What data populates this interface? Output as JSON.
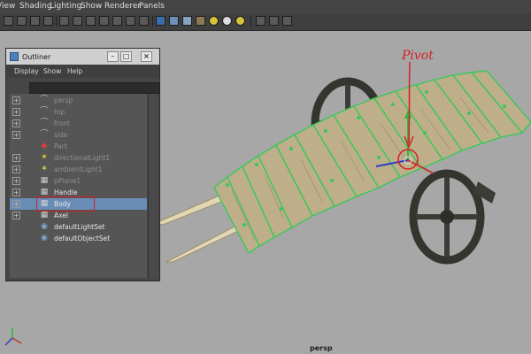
{
  "menu": [
    "View",
    "Shading",
    "Lighting",
    "Show",
    "Renderer",
    "Panels"
  ],
  "toolbar_icons": [
    "select-camera-icon",
    "camera-attributes-icon",
    "bookmark-icon",
    "image-plane-icon",
    "grid-icon",
    "film-gate-icon",
    "resolution-gate-icon",
    "gate-mask-icon",
    "field-chart-icon",
    "safe-action-icon",
    "safe-title-icon",
    "wireframe-icon",
    "smooth-shade-icon",
    "wireframe-on-shaded-icon",
    "textured-icon",
    "use-all-lights-icon",
    "shadows-icon",
    "isolate-select-icon",
    "xray-icon",
    "xray-joints-icon"
  ],
  "outliner": {
    "title": "Outliner",
    "menu": [
      "Display",
      "Show",
      "Help"
    ],
    "items": [
      {
        "label": "persp",
        "icon": "camera-icon",
        "dim": true,
        "expand": "+"
      },
      {
        "label": "top",
        "icon": "camera-icon",
        "dim": true,
        "expand": "+"
      },
      {
        "label": "front",
        "icon": "camera-icon",
        "dim": true,
        "expand": "+"
      },
      {
        "label": "side",
        "icon": "camera-icon",
        "dim": true,
        "expand": "+"
      },
      {
        "label": "Part",
        "icon": "group-icon",
        "dim": true,
        "expand": ""
      },
      {
        "label": "directionalLight1",
        "icon": "light-icon",
        "dim": true,
        "expand": "+"
      },
      {
        "label": "ambientLight1",
        "icon": "light-icon",
        "dim": true,
        "expand": "+"
      },
      {
        "label": "pPlane1",
        "icon": "mesh-icon",
        "dim": true,
        "expand": "+"
      },
      {
        "label": "Handle",
        "icon": "mesh-icon",
        "dim": false,
        "expand": "+"
      },
      {
        "label": "Body",
        "icon": "mesh-icon",
        "dim": false,
        "expand": "+",
        "selected": true
      },
      {
        "label": "Axel",
        "icon": "mesh-icon",
        "dim": false,
        "expand": "+"
      },
      {
        "label": "defaultLightSet",
        "icon": "set-icon",
        "dim": false,
        "expand": ""
      },
      {
        "label": "defaultObjectSet",
        "icon": "set-icon",
        "dim": false,
        "expand": ""
      }
    ]
  },
  "annotation": {
    "pivot_text": "Pivot"
  },
  "viewport": {
    "camera": "persp"
  },
  "colors": {
    "selection_wire": "#37c95a",
    "annotation": "#d42020",
    "viewport_bg": "#a7a7a7",
    "plank": "#bfae8a",
    "handle": "#e2d7b4",
    "wheel": "#3a3d36"
  }
}
